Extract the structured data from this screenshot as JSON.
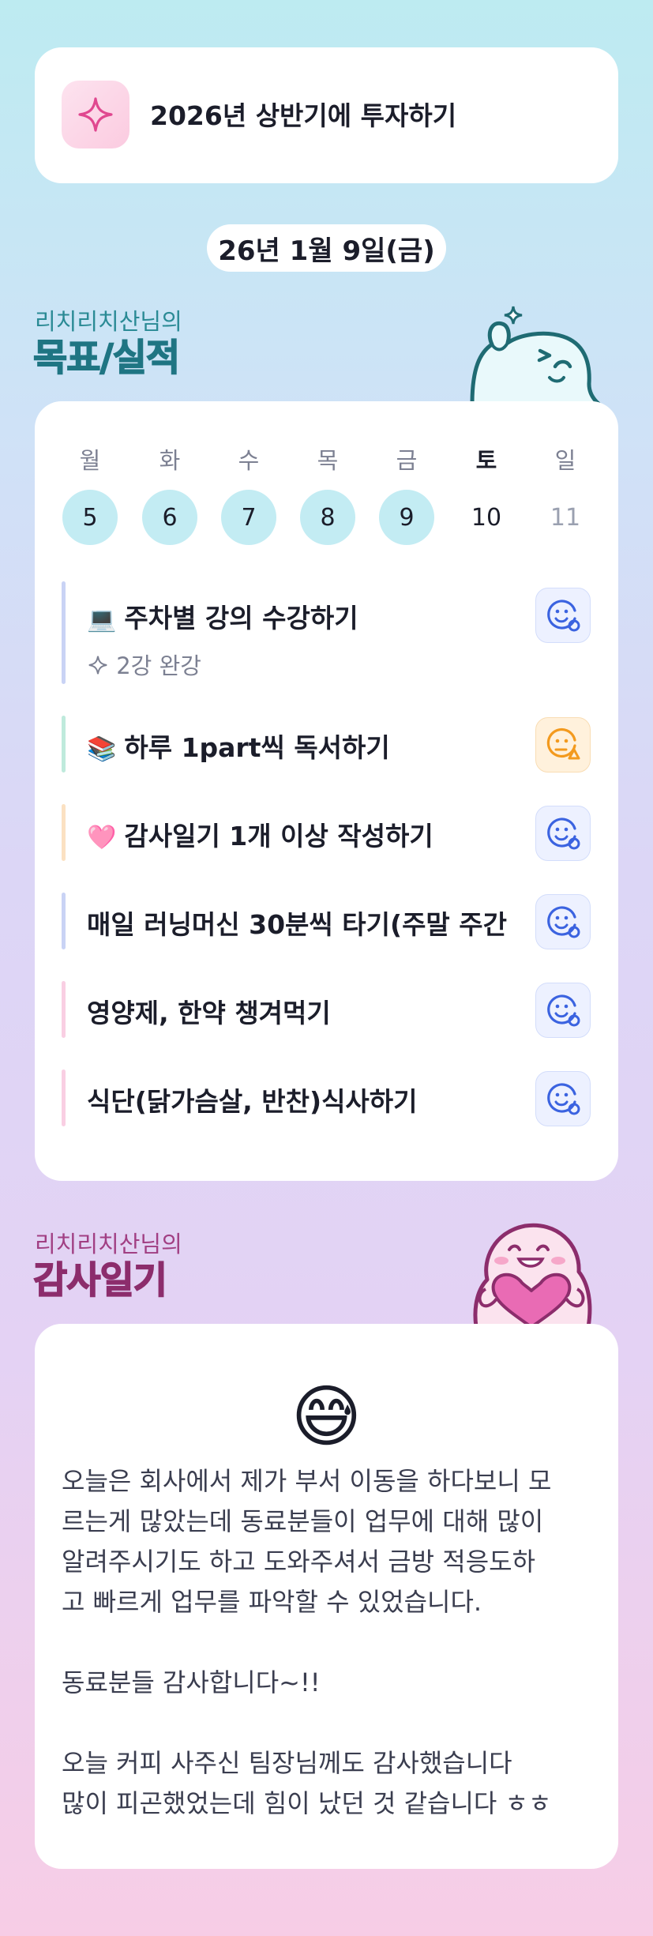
{
  "goal": {
    "title": "2026년 상반기에 투자하기",
    "icon": "sparkle-icon"
  },
  "date": "26년 1월 9일(금)",
  "goals_section": {
    "sub": "리치리치산님의",
    "title": "목표/실적"
  },
  "week": {
    "weekdays": [
      "월",
      "화",
      "수",
      "목",
      "금",
      "토",
      "일"
    ],
    "dates": [
      "5",
      "6",
      "7",
      "8",
      "9",
      "10",
      "11"
    ]
  },
  "goals": [
    {
      "emoji": "💻",
      "text": "주차별 강의 수강하기",
      "sub": "2강 완강",
      "status_icon": "smile-face-icon",
      "bar_color": "#c9d3f5"
    },
    {
      "emoji": "📚",
      "text": "하루 1part씩 독서하기",
      "status_icon": "meh-face-warning-icon",
      "bar_color": "#bfeadc"
    },
    {
      "emoji": "🩷",
      "text": "감사일기 1개 이상 작성하기",
      "status_icon": "smile-face-icon",
      "bar_color": "#fbe1c2"
    },
    {
      "emoji": "",
      "text": "매일 러닝머신 30분씩 타기(주말 주간",
      "status_icon": "smile-face-icon",
      "bar_color": "#c9d3f5"
    },
    {
      "emoji": "",
      "text": "영양제, 한약 챙겨먹기",
      "status_icon": "smile-face-icon",
      "bar_color": "#f9cfe3"
    },
    {
      "emoji": "",
      "text": "식단(닭가슴살, 반찬)식사하기",
      "status_icon": "smile-face-icon",
      "bar_color": "#f9cfe3"
    }
  ],
  "thanks_section": {
    "sub": "리치리치산님의",
    "title": "감사일기"
  },
  "diary": {
    "emoji": "😅",
    "text": "오늘은 회사에서 제가 부서 이동을 하다보니 모\n르는게 많았는데 동료분들이 업무에 대해 많이\n알려주시기도 하고 도와주셔서 금방 적응도하\n고 빠르게 업무를 파악할 수 있었습니다.\n\n동료분들 감사합니다~!!\n\n오늘 커피 사주신 팀장님께도 감사했습니다\n많이 피곤했었는데 힘이 났던 것 같습니다 ㅎㅎ"
  },
  "colors": {
    "accent_blue": "#3b63e0",
    "accent_orange": "#f39a1e",
    "teal": "#1f7583",
    "plum": "#8c2d6c"
  }
}
